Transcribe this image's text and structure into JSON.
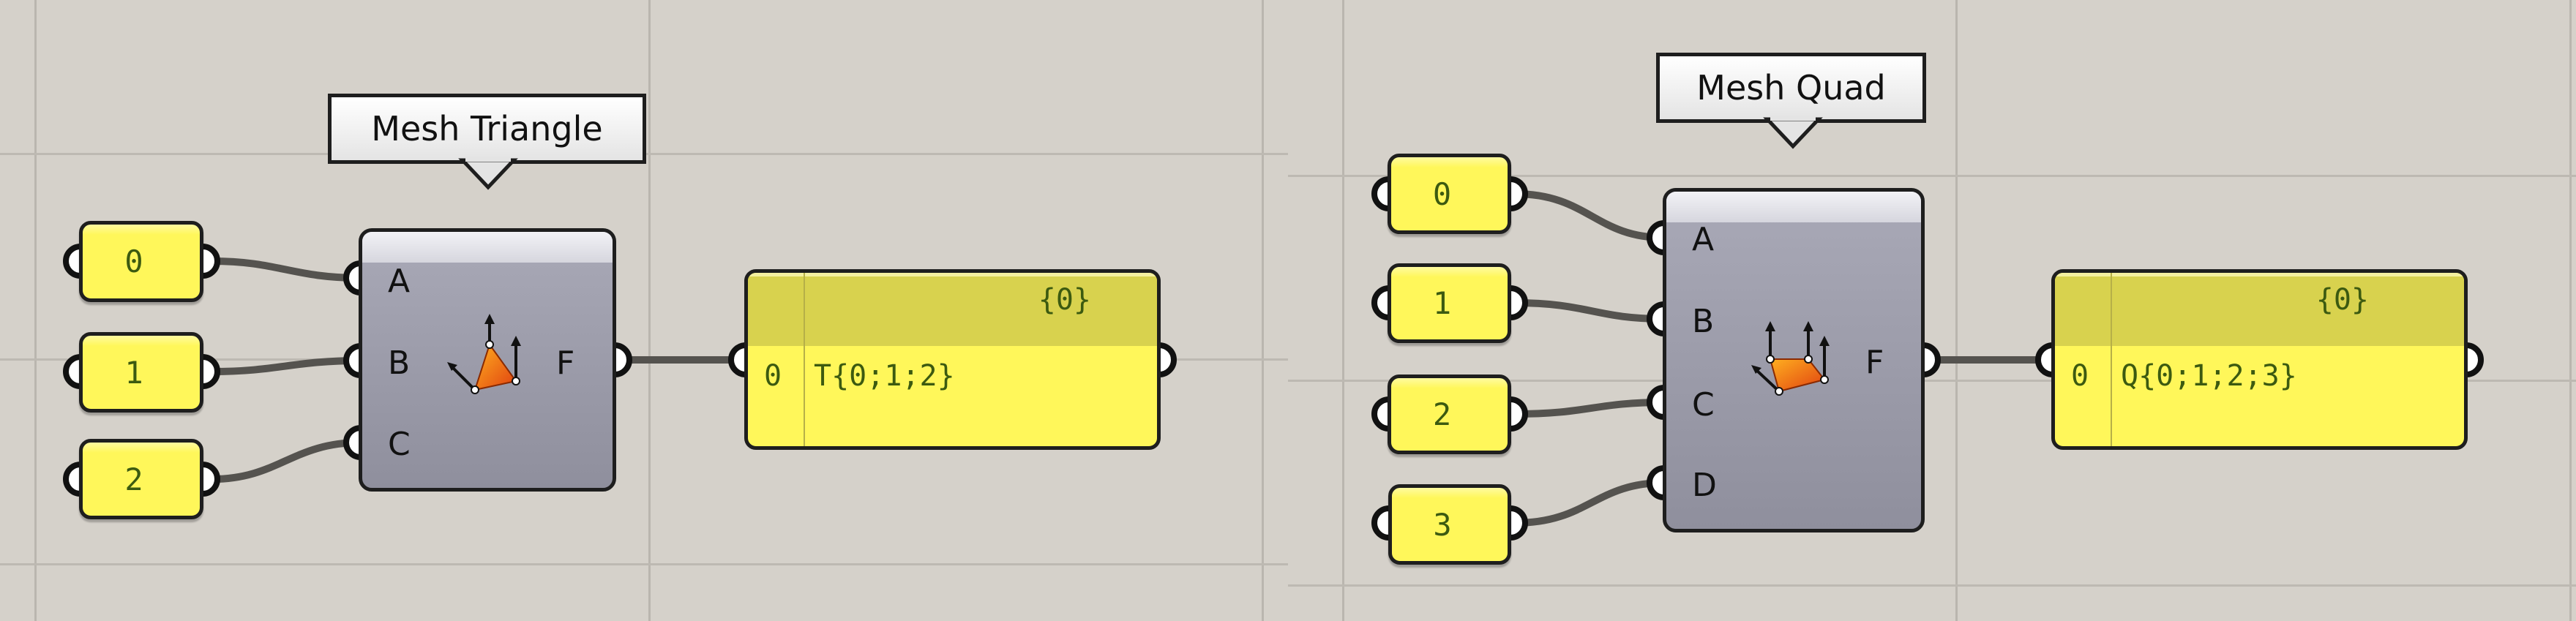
{
  "canvas": {
    "background": "#d5d1ca",
    "wire_color": "#55534f",
    "slider_fill": "#fff75a",
    "slider_text_color": "#3c5a10",
    "panel_header_fill": "#d8d24e",
    "component_fill": "#a6a6b4"
  },
  "left_example": {
    "tooltip": "Mesh Triangle",
    "sliders": [
      {
        "value": "0"
      },
      {
        "value": "1"
      },
      {
        "value": "2"
      }
    ],
    "component": {
      "name": "Mesh Triangle",
      "icon": "mesh-triangle-icon",
      "inputs": [
        "A",
        "B",
        "C"
      ],
      "output": "F"
    },
    "panel": {
      "path": "{0}",
      "rows": [
        {
          "index": "0",
          "value": "T{0;1;2}"
        }
      ]
    }
  },
  "right_example": {
    "tooltip": "Mesh Quad",
    "sliders": [
      {
        "value": "0"
      },
      {
        "value": "1"
      },
      {
        "value": "2"
      },
      {
        "value": "3"
      }
    ],
    "component": {
      "name": "Mesh Quad",
      "icon": "mesh-quad-icon",
      "inputs": [
        "A",
        "B",
        "C",
        "D"
      ],
      "output": "F"
    },
    "panel": {
      "path": "{0}",
      "rows": [
        {
          "index": "0",
          "value": "Q{0;1;2;3}"
        }
      ]
    }
  }
}
